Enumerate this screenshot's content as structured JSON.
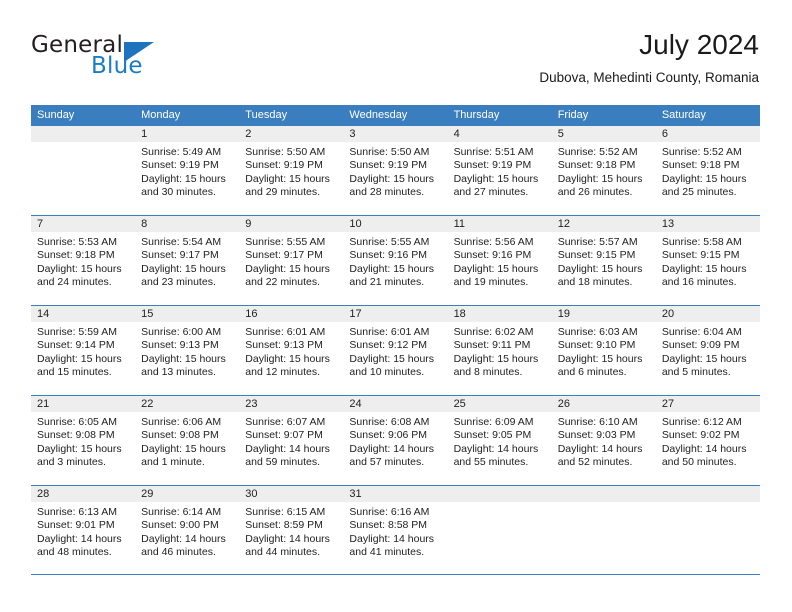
{
  "brand": {
    "name_part1": "General",
    "name_part2": "Blue",
    "triangle_icon": "brand-triangle-icon",
    "colors": {
      "dark": "#231f20",
      "blue": "#1a7dc4",
      "triangle": "#1e73be"
    }
  },
  "header": {
    "title": "July 2024",
    "location": "Dubova, Mehedinti County, Romania"
  },
  "theme": {
    "header_blue": "#3b7ebf",
    "day_band_gray": "#eeeeee",
    "text": "#222222"
  },
  "weekdays": [
    "Sunday",
    "Monday",
    "Tuesday",
    "Wednesday",
    "Thursday",
    "Friday",
    "Saturday"
  ],
  "weeks": [
    [
      {
        "day": "",
        "sunrise": "",
        "sunset": "",
        "daylight1": "",
        "daylight2": ""
      },
      {
        "day": "1",
        "sunrise": "Sunrise: 5:49 AM",
        "sunset": "Sunset: 9:19 PM",
        "daylight1": "Daylight: 15 hours",
        "daylight2": "and 30 minutes."
      },
      {
        "day": "2",
        "sunrise": "Sunrise: 5:50 AM",
        "sunset": "Sunset: 9:19 PM",
        "daylight1": "Daylight: 15 hours",
        "daylight2": "and 29 minutes."
      },
      {
        "day": "3",
        "sunrise": "Sunrise: 5:50 AM",
        "sunset": "Sunset: 9:19 PM",
        "daylight1": "Daylight: 15 hours",
        "daylight2": "and 28 minutes."
      },
      {
        "day": "4",
        "sunrise": "Sunrise: 5:51 AM",
        "sunset": "Sunset: 9:19 PM",
        "daylight1": "Daylight: 15 hours",
        "daylight2": "and 27 minutes."
      },
      {
        "day": "5",
        "sunrise": "Sunrise: 5:52 AM",
        "sunset": "Sunset: 9:18 PM",
        "daylight1": "Daylight: 15 hours",
        "daylight2": "and 26 minutes."
      },
      {
        "day": "6",
        "sunrise": "Sunrise: 5:52 AM",
        "sunset": "Sunset: 9:18 PM",
        "daylight1": "Daylight: 15 hours",
        "daylight2": "and 25 minutes."
      }
    ],
    [
      {
        "day": "7",
        "sunrise": "Sunrise: 5:53 AM",
        "sunset": "Sunset: 9:18 PM",
        "daylight1": "Daylight: 15 hours",
        "daylight2": "and 24 minutes."
      },
      {
        "day": "8",
        "sunrise": "Sunrise: 5:54 AM",
        "sunset": "Sunset: 9:17 PM",
        "daylight1": "Daylight: 15 hours",
        "daylight2": "and 23 minutes."
      },
      {
        "day": "9",
        "sunrise": "Sunrise: 5:55 AM",
        "sunset": "Sunset: 9:17 PM",
        "daylight1": "Daylight: 15 hours",
        "daylight2": "and 22 minutes."
      },
      {
        "day": "10",
        "sunrise": "Sunrise: 5:55 AM",
        "sunset": "Sunset: 9:16 PM",
        "daylight1": "Daylight: 15 hours",
        "daylight2": "and 21 minutes."
      },
      {
        "day": "11",
        "sunrise": "Sunrise: 5:56 AM",
        "sunset": "Sunset: 9:16 PM",
        "daylight1": "Daylight: 15 hours",
        "daylight2": "and 19 minutes."
      },
      {
        "day": "12",
        "sunrise": "Sunrise: 5:57 AM",
        "sunset": "Sunset: 9:15 PM",
        "daylight1": "Daylight: 15 hours",
        "daylight2": "and 18 minutes."
      },
      {
        "day": "13",
        "sunrise": "Sunrise: 5:58 AM",
        "sunset": "Sunset: 9:15 PM",
        "daylight1": "Daylight: 15 hours",
        "daylight2": "and 16 minutes."
      }
    ],
    [
      {
        "day": "14",
        "sunrise": "Sunrise: 5:59 AM",
        "sunset": "Sunset: 9:14 PM",
        "daylight1": "Daylight: 15 hours",
        "daylight2": "and 15 minutes."
      },
      {
        "day": "15",
        "sunrise": "Sunrise: 6:00 AM",
        "sunset": "Sunset: 9:13 PM",
        "daylight1": "Daylight: 15 hours",
        "daylight2": "and 13 minutes."
      },
      {
        "day": "16",
        "sunrise": "Sunrise: 6:01 AM",
        "sunset": "Sunset: 9:13 PM",
        "daylight1": "Daylight: 15 hours",
        "daylight2": "and 12 minutes."
      },
      {
        "day": "17",
        "sunrise": "Sunrise: 6:01 AM",
        "sunset": "Sunset: 9:12 PM",
        "daylight1": "Daylight: 15 hours",
        "daylight2": "and 10 minutes."
      },
      {
        "day": "18",
        "sunrise": "Sunrise: 6:02 AM",
        "sunset": "Sunset: 9:11 PM",
        "daylight1": "Daylight: 15 hours",
        "daylight2": "and 8 minutes."
      },
      {
        "day": "19",
        "sunrise": "Sunrise: 6:03 AM",
        "sunset": "Sunset: 9:10 PM",
        "daylight1": "Daylight: 15 hours",
        "daylight2": "and 6 minutes."
      },
      {
        "day": "20",
        "sunrise": "Sunrise: 6:04 AM",
        "sunset": "Sunset: 9:09 PM",
        "daylight1": "Daylight: 15 hours",
        "daylight2": "and 5 minutes."
      }
    ],
    [
      {
        "day": "21",
        "sunrise": "Sunrise: 6:05 AM",
        "sunset": "Sunset: 9:08 PM",
        "daylight1": "Daylight: 15 hours",
        "daylight2": "and 3 minutes."
      },
      {
        "day": "22",
        "sunrise": "Sunrise: 6:06 AM",
        "sunset": "Sunset: 9:08 PM",
        "daylight1": "Daylight: 15 hours",
        "daylight2": "and 1 minute."
      },
      {
        "day": "23",
        "sunrise": "Sunrise: 6:07 AM",
        "sunset": "Sunset: 9:07 PM",
        "daylight1": "Daylight: 14 hours",
        "daylight2": "and 59 minutes."
      },
      {
        "day": "24",
        "sunrise": "Sunrise: 6:08 AM",
        "sunset": "Sunset: 9:06 PM",
        "daylight1": "Daylight: 14 hours",
        "daylight2": "and 57 minutes."
      },
      {
        "day": "25",
        "sunrise": "Sunrise: 6:09 AM",
        "sunset": "Sunset: 9:05 PM",
        "daylight1": "Daylight: 14 hours",
        "daylight2": "and 55 minutes."
      },
      {
        "day": "26",
        "sunrise": "Sunrise: 6:10 AM",
        "sunset": "Sunset: 9:03 PM",
        "daylight1": "Daylight: 14 hours",
        "daylight2": "and 52 minutes."
      },
      {
        "day": "27",
        "sunrise": "Sunrise: 6:12 AM",
        "sunset": "Sunset: 9:02 PM",
        "daylight1": "Daylight: 14 hours",
        "daylight2": "and 50 minutes."
      }
    ],
    [
      {
        "day": "28",
        "sunrise": "Sunrise: 6:13 AM",
        "sunset": "Sunset: 9:01 PM",
        "daylight1": "Daylight: 14 hours",
        "daylight2": "and 48 minutes."
      },
      {
        "day": "29",
        "sunrise": "Sunrise: 6:14 AM",
        "sunset": "Sunset: 9:00 PM",
        "daylight1": "Daylight: 14 hours",
        "daylight2": "and 46 minutes."
      },
      {
        "day": "30",
        "sunrise": "Sunrise: 6:15 AM",
        "sunset": "Sunset: 8:59 PM",
        "daylight1": "Daylight: 14 hours",
        "daylight2": "and 44 minutes."
      },
      {
        "day": "31",
        "sunrise": "Sunrise: 6:16 AM",
        "sunset": "Sunset: 8:58 PM",
        "daylight1": "Daylight: 14 hours",
        "daylight2": "and 41 minutes."
      },
      {
        "day": "",
        "sunrise": "",
        "sunset": "",
        "daylight1": "",
        "daylight2": ""
      },
      {
        "day": "",
        "sunrise": "",
        "sunset": "",
        "daylight1": "",
        "daylight2": ""
      },
      {
        "day": "",
        "sunrise": "",
        "sunset": "",
        "daylight1": "",
        "daylight2": ""
      }
    ]
  ]
}
